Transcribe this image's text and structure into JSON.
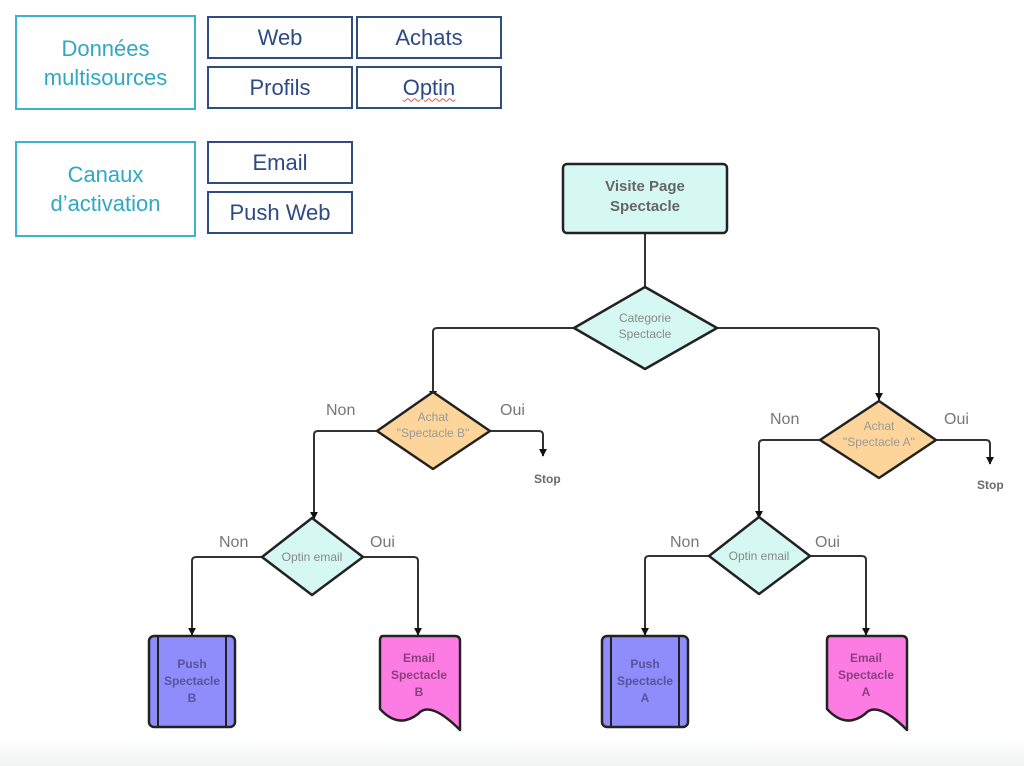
{
  "legend": {
    "sources": {
      "label_line1": "Données",
      "label_line2": "multisources",
      "items": [
        "Web",
        "Achats",
        "Profils",
        "Optin"
      ]
    },
    "channels": {
      "label_line1": "Canaux",
      "label_line2": "d’activation",
      "items": [
        "Email",
        "Push Web"
      ]
    }
  },
  "flow": {
    "start": {
      "line1": "Visite Page",
      "line2": "Spectacle"
    },
    "category_decision": {
      "line1": "Categorie",
      "line2": "Spectacle"
    },
    "branch_b": {
      "purchase_decision": {
        "line1": "Achat",
        "line2": "\"Spectacle B\""
      },
      "no_label": "Non",
      "yes_label": "Oui",
      "stop": "Stop",
      "optin_decision": "Optin email",
      "optin_no_label": "Non",
      "optin_yes_label": "Oui",
      "push": {
        "line1": "Push",
        "line2": "Spectacle",
        "line3": "B"
      },
      "email": {
        "line1": "Email",
        "line2": "Spectacle",
        "line3": "B"
      }
    },
    "branch_a": {
      "purchase_decision": {
        "line1": "Achat",
        "line2": "\"Spectacle A\""
      },
      "no_label": "Non",
      "yes_label": "Oui",
      "stop": "Stop",
      "optin_decision": "Optin email",
      "optin_no_label": "Non",
      "optin_yes_label": "Oui",
      "push": {
        "line1": "Push",
        "line2": "Spectacle",
        "line3": "A"
      },
      "email": {
        "line1": "Email",
        "line2": "Spectacle",
        "line3": "A"
      }
    }
  },
  "colors": {
    "category_border": "#3cb3cc",
    "category_text": "#31a8c2",
    "item_border": "#2f4d7e",
    "item_text": "#2d4a86",
    "decision_fill": "#d5f8f2",
    "purchase_fill": "#fdd59a",
    "push_fill": "#8f8cfb",
    "email_fill": "#fc7ce4",
    "stroke": "#222222"
  }
}
